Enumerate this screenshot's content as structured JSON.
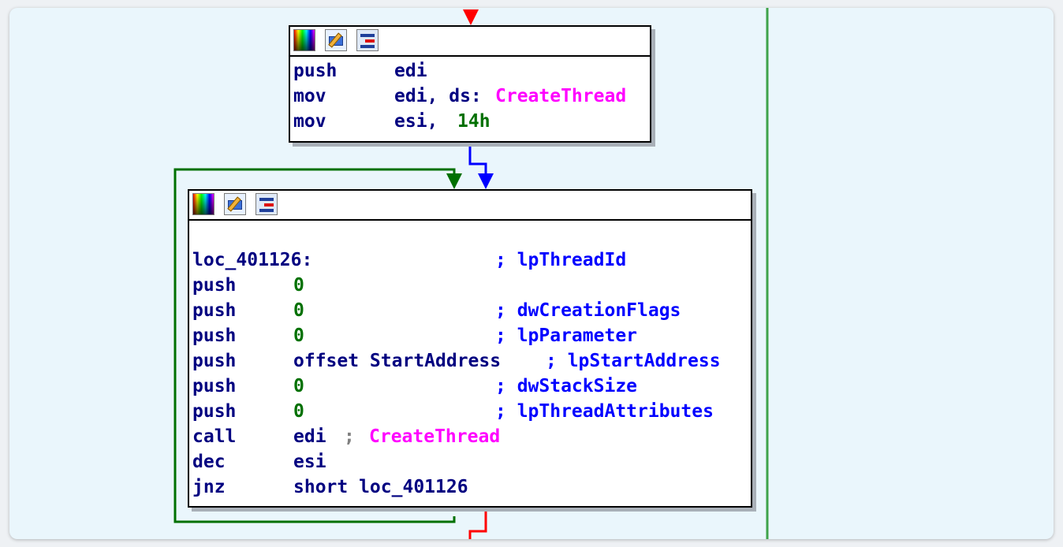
{
  "colors": {
    "canvas_bg": "#eaf6fc",
    "node_bg": "#ffffff",
    "mnemonic": "#000080",
    "number": "#007000",
    "import_symbol": "#ff00ff",
    "comment": "#0000ff",
    "edge_true": "#007000",
    "edge_false": "#ff0000",
    "edge_unconditional": "#0000ff"
  },
  "node_toolbar_icons": [
    "color-palette-icon",
    "rename-pencil-icon",
    "graph-overview-icon"
  ],
  "blocks": [
    {
      "id": "block-1",
      "lines": [
        {
          "mnemonic": "push",
          "operand": "edi"
        },
        {
          "mnemonic": "mov",
          "operand": "edi, ds:",
          "symbol": "CreateThread"
        },
        {
          "mnemonic": "mov",
          "operand": "esi, ",
          "number": "14h"
        }
      ]
    },
    {
      "id": "block-2",
      "lines": [
        {
          "label": "loc_401126:",
          "comment": "; lpThreadId"
        },
        {
          "mnemonic": "push",
          "number": "0"
        },
        {
          "mnemonic": "push",
          "number": "0",
          "comment": "; dwCreationFlags"
        },
        {
          "mnemonic": "push",
          "number": "0",
          "comment": "; lpParameter"
        },
        {
          "mnemonic": "push",
          "operand": "offset StartAddress",
          "comment": "; lpStartAddress"
        },
        {
          "mnemonic": "push",
          "number": "0",
          "comment": "; dwStackSize"
        },
        {
          "mnemonic": "push",
          "number": "0",
          "comment": "; lpThreadAttributes"
        },
        {
          "mnemonic": "call",
          "operand": "edi",
          "semi": ";",
          "symbol": "CreateThread"
        },
        {
          "mnemonic": "dec",
          "operand": "esi"
        },
        {
          "mnemonic": "jnz",
          "operand": "short loc_401126"
        }
      ]
    }
  ]
}
